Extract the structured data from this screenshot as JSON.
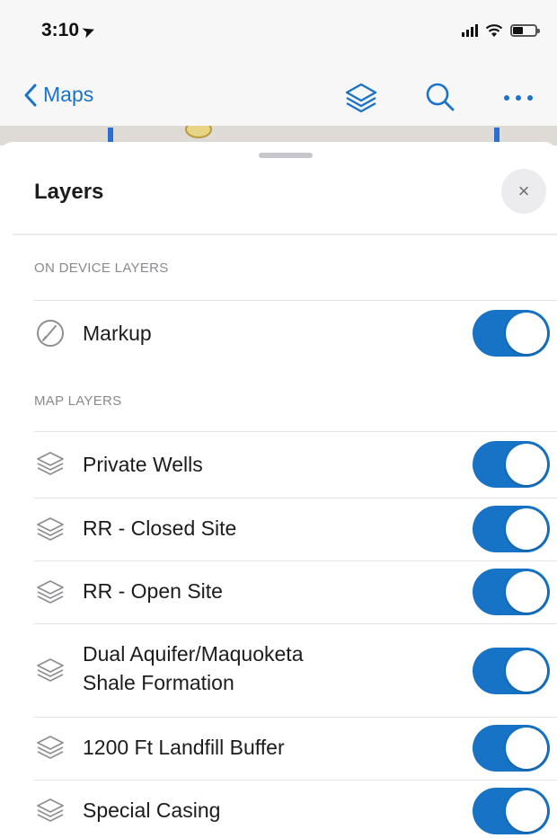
{
  "status_bar": {
    "time": "3:10"
  },
  "nav": {
    "back_label": "Maps"
  },
  "sheet": {
    "title": "Layers",
    "close_symbol": "×"
  },
  "sections": {
    "on_device": "ON DEVICE LAYERS",
    "map_layers": "MAP LAYERS"
  },
  "layers": {
    "markup": {
      "label": "Markup",
      "icon": "markup-icon",
      "enabled": true
    },
    "private_wells": {
      "label": "Private Wells",
      "icon": "layers-icon",
      "enabled": true
    },
    "rr_closed": {
      "label": "RR - Closed Site",
      "icon": "layers-icon",
      "enabled": true
    },
    "rr_open": {
      "label": "RR - Open Site",
      "icon": "layers-icon",
      "enabled": true
    },
    "dual_aquifer_line1": "Dual Aquifer/Maquoketa",
    "dual_aquifer_line2": "Shale Formation",
    "dual_aquifer": {
      "icon": "layers-icon",
      "enabled": true
    },
    "landfill_buffer": {
      "label": "1200 Ft Landfill Buffer",
      "icon": "layers-icon",
      "enabled": true
    },
    "special_casing": {
      "label": "Special Casing",
      "icon": "layers-icon",
      "enabled": true
    }
  },
  "colors": {
    "accent": "#1a73c8",
    "toggle_on": "#1773c6",
    "section_text": "#8a8a8e"
  }
}
